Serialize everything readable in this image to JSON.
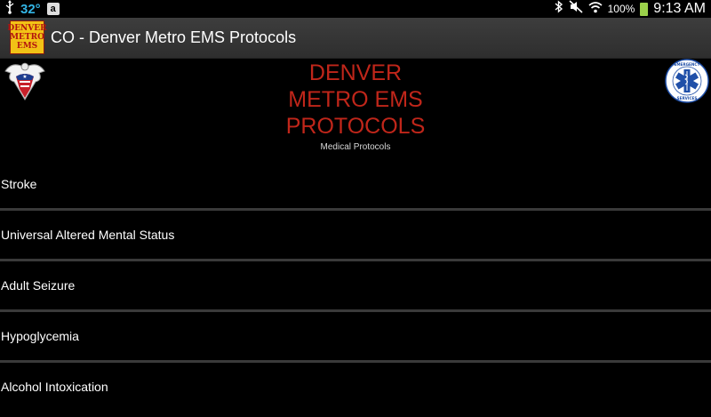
{
  "statusbar": {
    "temperature": "32°",
    "amazon_icon": "a",
    "battery": "100%",
    "time": "9:13 AM",
    "icons": [
      "usb-icon",
      "amazon-icon",
      "bluetooth-icon",
      "mute-icon",
      "wifi-icon",
      "battery-icon"
    ]
  },
  "actionbar": {
    "title": "CO - Denver Metro EMS Protocols",
    "logo_text": [
      "DENVER",
      "METRO",
      "EMS"
    ]
  },
  "header": {
    "title_lines": [
      "DENVER",
      "METRO EMS",
      "PROTOCOLS"
    ],
    "subtitle": "Medical Protocols",
    "right_emblem_text": "EMERGENCY MEDICAL SERVICES"
  },
  "list": {
    "items": [
      {
        "label": "Stroke"
      },
      {
        "label": "Universal Altered Mental Status"
      },
      {
        "label": "Adult Seizure"
      },
      {
        "label": "Hypoglycemia"
      },
      {
        "label": "Alcohol Intoxication"
      }
    ]
  },
  "colors": {
    "title_red": "#c0261a",
    "temp_blue": "#33b5e5",
    "logo_yellow": "#f2c216",
    "star_of_life_blue": "#1f4fa8"
  }
}
